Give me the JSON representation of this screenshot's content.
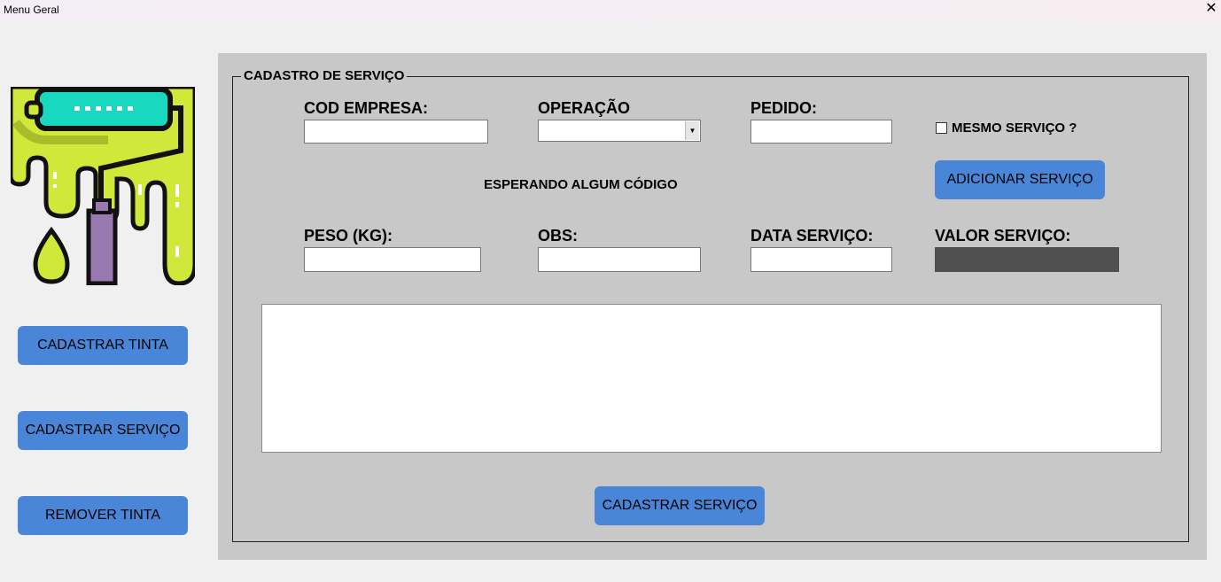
{
  "window": {
    "title": "Menu Geral",
    "close_glyph": "✕"
  },
  "sidebar": {
    "logo_icon": "paint-roller-icon",
    "buttons": [
      {
        "label": "CADASTRAR TINTA"
      },
      {
        "label": "CADASTRAR SERVIÇO"
      },
      {
        "label": "REMOVER TINTA"
      }
    ]
  },
  "form": {
    "group_title": "CADASTRO DE SERVIÇO",
    "cod_empresa": {
      "label": "COD EMPRESA:",
      "value": ""
    },
    "operacao": {
      "label": "OPERAÇÃO",
      "value": "",
      "arrow_glyph": "▼"
    },
    "pedido": {
      "label": "PEDIDO:",
      "value": ""
    },
    "mesmo_servico": {
      "label": "MESMO SERVIÇO ?",
      "checked": false
    },
    "add_button": "ADICIONAR SERVIÇO",
    "status_text": "ESPERANDO ALGUM CÓDIGO",
    "peso": {
      "label": "PESO (KG):",
      "value": ""
    },
    "obs": {
      "label": "OBS:",
      "value": ""
    },
    "data_servico": {
      "label": "DATA SERVIÇO:",
      "value": ""
    },
    "valor_servico": {
      "label": "VALOR SERVIÇO:",
      "value": ""
    },
    "submit_button": "CADASTRAR SERVIÇO"
  },
  "colors": {
    "button": "#4a86d8",
    "panel": "#c8c8c8",
    "valor_box": "#505050",
    "paint_green": "#cfe83a",
    "roller_teal": "#18d8c0"
  }
}
